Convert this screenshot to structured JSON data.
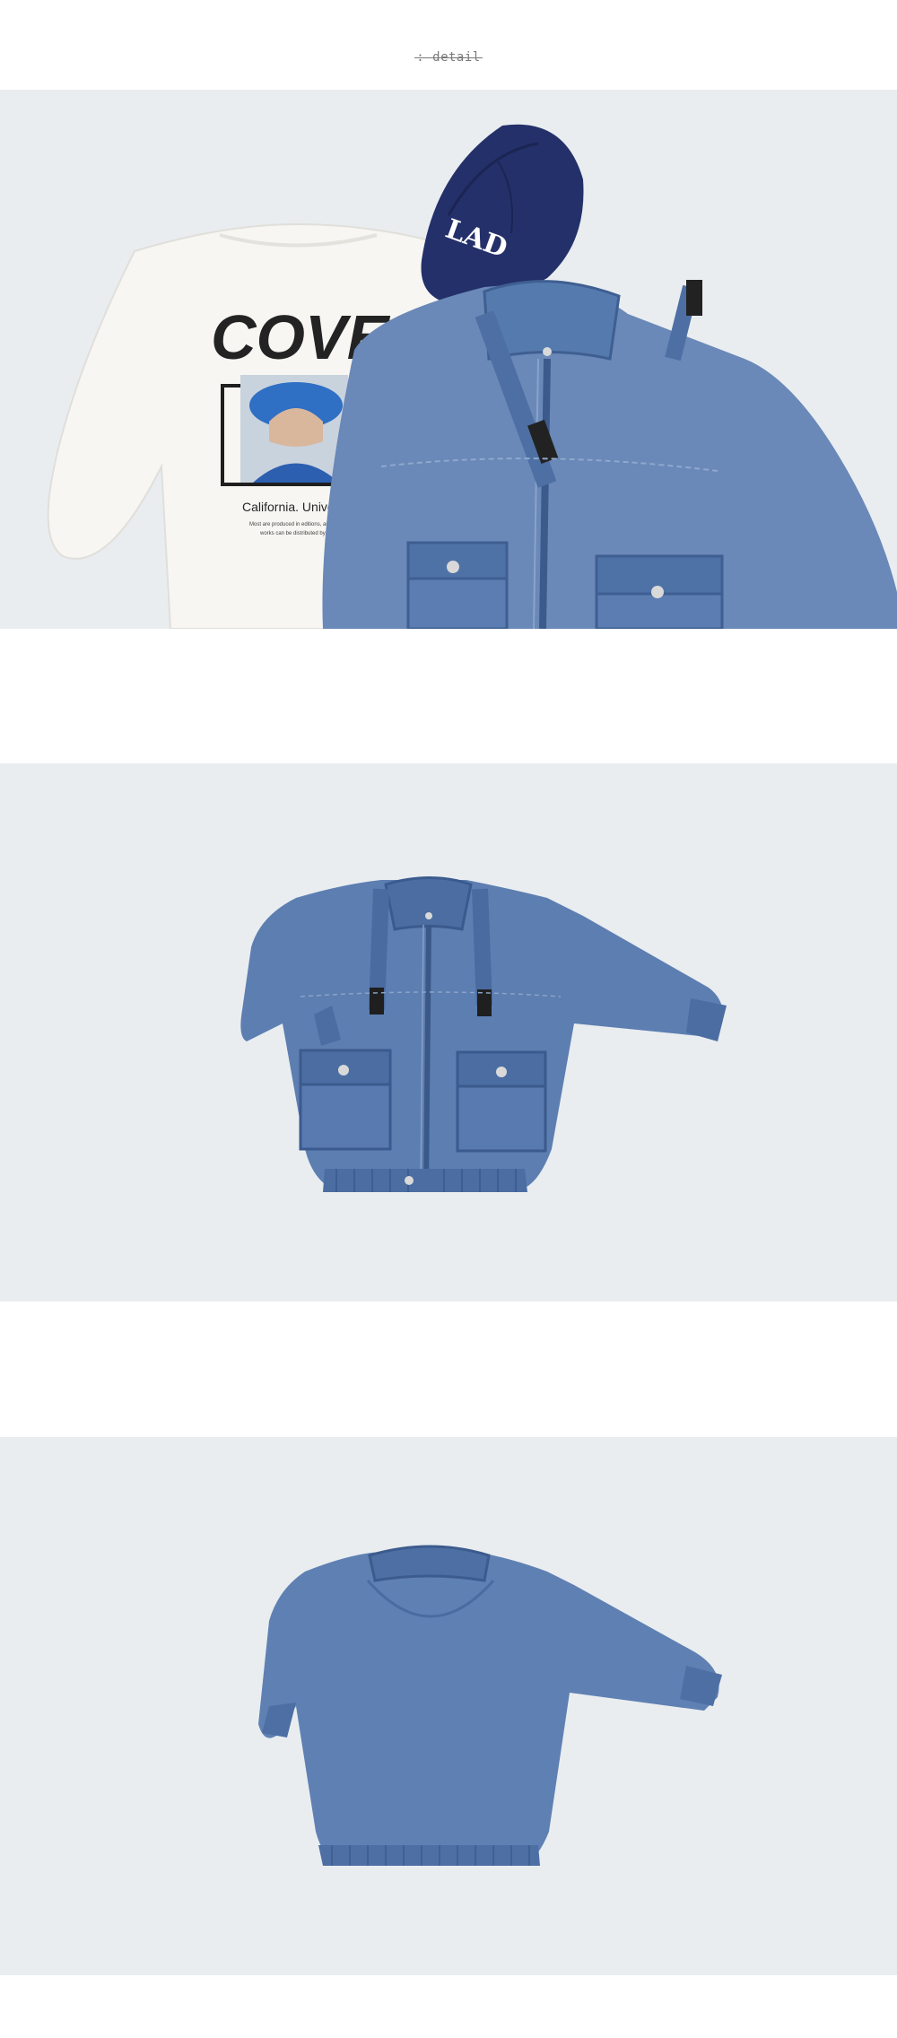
{
  "header": {
    "detail_label": ": detail"
  },
  "photos": [
    {
      "content_items": [
        "white-sweatshirt",
        "navy-cap",
        "denim-jacket"
      ],
      "printed_text": {
        "sweatshirt_headline": "COVER",
        "sweatshirt_caption": "California. Univers",
        "sweatshirt_fine_print_1": "Most are produced in editions, and",
        "sweatshirt_fine_print_2": "works can be distributed by",
        "cap_logo": "LAD"
      }
    },
    {
      "content_items": [
        "denim-jacket-front"
      ]
    },
    {
      "content_items": [
        "denim-jacket-back"
      ]
    }
  ],
  "colors": {
    "page_background": "#ffffff",
    "photo_background": "#e9edf0",
    "denim": "#5d7eb1",
    "denim_dark": "#3f5f92",
    "cap_navy": "#24306a",
    "sweatshirt": "#f7f6f2"
  }
}
